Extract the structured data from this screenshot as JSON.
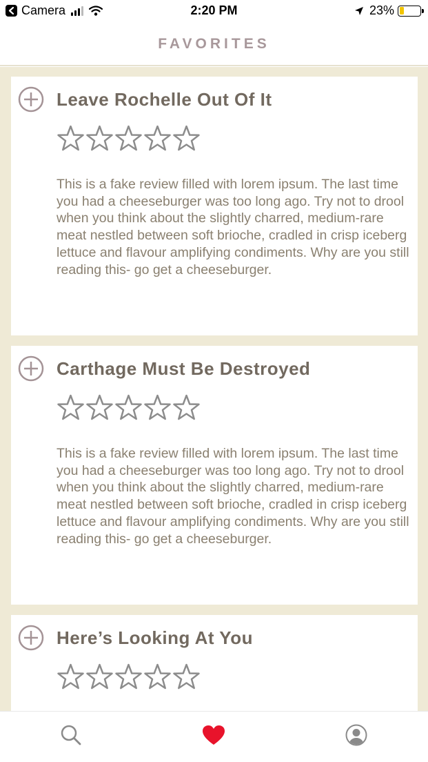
{
  "status_bar": {
    "back_app": "Camera",
    "time": "2:20 PM",
    "battery_percent": "23%",
    "battery_level": 0.23
  },
  "header": {
    "title": "FAVORITES"
  },
  "colors": {
    "background": "#efead6",
    "card": "#ffffff",
    "title": "#72695f",
    "body_text": "#8a8070",
    "header_title": "#a8989b",
    "accent_heart": "#e8132b",
    "star_outline": "#8c8c8c",
    "plus_icon": "#a49396"
  },
  "favorites": [
    {
      "title": "Leave Rochelle Out Of It",
      "rating": 0,
      "max_rating": 5,
      "review": "This is a fake review filled with lorem ipsum. The last time you had a cheeseburger was too long ago. Try not to drool when you think about the slightly charred, medium-rare meat nestled between soft brioche, cradled in crisp iceberg lettuce and flavour amplifying condiments. Why are you still reading this- go get a cheeseburger."
    },
    {
      "title": "Carthage Must Be Destroyed",
      "rating": 0,
      "max_rating": 5,
      "review": "This is a fake review filled with lorem ipsum. The last time you had a cheeseburger was too long ago. Try not to drool when you think about the slightly charred, medium-rare meat nestled between soft brioche, cradled in crisp iceberg lettuce and flavour amplifying condiments. Why are you still reading this- go get a cheeseburger."
    },
    {
      "title": "Here’s Looking At You",
      "rating": 0,
      "max_rating": 5,
      "review": ""
    }
  ],
  "tabbar": {
    "tabs": [
      {
        "icon": "search-icon",
        "active": false
      },
      {
        "icon": "heart-icon",
        "active": true
      },
      {
        "icon": "profile-icon",
        "active": false
      }
    ]
  }
}
